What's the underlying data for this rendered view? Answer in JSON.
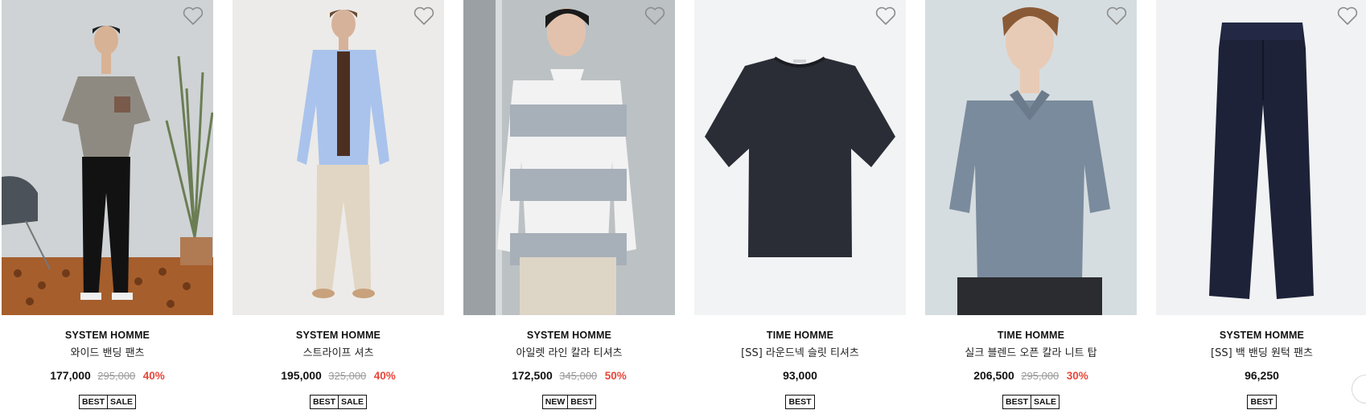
{
  "products": [
    {
      "brand": "SYSTEM HOMME",
      "name": "와이드 밴딩 팬츠",
      "price": "177,000",
      "original_price": "295,000",
      "discount": "40%",
      "badges": [
        "BEST",
        "SALE"
      ]
    },
    {
      "brand": "SYSTEM HOMME",
      "name": "스트라이프 셔츠",
      "price": "195,000",
      "original_price": "325,000",
      "discount": "40%",
      "badges": [
        "BEST",
        "SALE"
      ]
    },
    {
      "brand": "SYSTEM HOMME",
      "name": "아일렛 라인 칼라 티셔츠",
      "price": "172,500",
      "original_price": "345,000",
      "discount": "50%",
      "badges": [
        "NEW",
        "BEST"
      ]
    },
    {
      "brand": "TIME HOMME",
      "name": "[SS] 라운드넥 슬릿 티셔츠",
      "price": "93,000",
      "original_price": "",
      "discount": "",
      "badges": [
        "BEST"
      ]
    },
    {
      "brand": "TIME HOMME",
      "name": "실크 블렌드 오픈 칼라 니트 탑",
      "price": "206,500",
      "original_price": "295,000",
      "discount": "30%",
      "badges": [
        "BEST",
        "SALE"
      ]
    },
    {
      "brand": "SYSTEM HOMME",
      "name": "[SS] 백 밴딩 원턱 팬츠",
      "price": "96,250",
      "original_price": "",
      "discount": "",
      "badges": [
        "BEST"
      ]
    }
  ],
  "icons": {
    "wishlist": "heart-outline-icon"
  },
  "colors": {
    "discount": "#e8463a",
    "strike": "#9a9a9a"
  }
}
